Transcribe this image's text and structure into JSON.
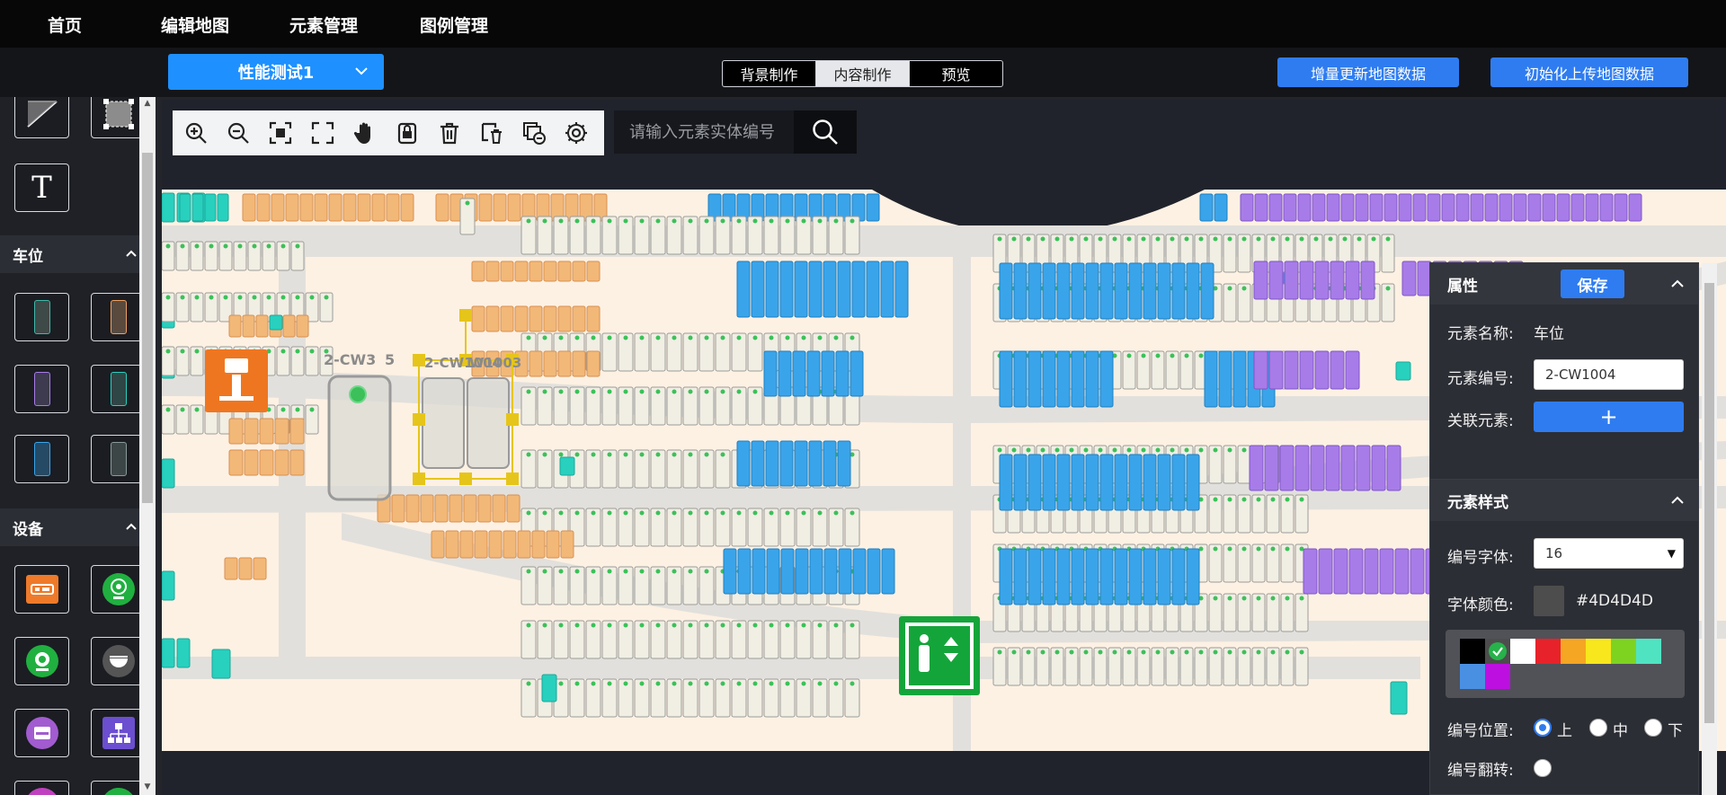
{
  "nav": {
    "items": [
      "首页",
      "编辑地图",
      "元素管理",
      "图例管理"
    ]
  },
  "subbar": {
    "project": "性能测试1",
    "tabs": [
      "背景制作",
      "内容制作",
      "预览"
    ],
    "active_tab": "内容制作",
    "incremental_update": "增量更新地图数据",
    "init_upload": "初始化上传地图数据"
  },
  "sidebar": {
    "sections": {
      "parking": "车位",
      "device": "设备"
    },
    "tools": [
      "polyline-tool",
      "rect-select-tool",
      "text-tool"
    ],
    "text_tool_glyph": "T"
  },
  "map": {
    "search_placeholder": "请输入元素实体编号",
    "labels": {
      "space_a": "2-CW3",
      "space_a_suffix": "5",
      "space_b": "2-CW1004",
      "space_c": "W1003"
    },
    "toolbar": [
      "zoom-in-icon",
      "zoom-out-icon",
      "fit-icon",
      "fullscreen-icon",
      "hand-icon",
      "lock-icon",
      "delete-icon",
      "delete-layer-icon",
      "remove-layer-icon",
      "settings-icon"
    ]
  },
  "props": {
    "title": "属性",
    "save": "保存",
    "name_label": "元素名称:",
    "name_value": "车位",
    "code_label": "元素编号:",
    "code_value": "2-CW1004",
    "link_label": "关联元素:",
    "link_btn": "+"
  },
  "style": {
    "title": "元素样式",
    "font_label": "编号字体:",
    "font_value": "16",
    "color_label": "字体颜色:",
    "color_value": "#4D4D4D",
    "palette": [
      "#000000",
      "#4D4D4D",
      "#FFFFFF",
      "#E8222A",
      "#F5A623",
      "#F8E71C",
      "#7ED321",
      "#50E3C2",
      "#4A90E2",
      "#BD10E0"
    ],
    "pos_label": "编号位置:",
    "pos_options": [
      "上",
      "中",
      "下"
    ],
    "pos_selected": "上",
    "flip_label": "编号翻转:"
  },
  "colors": {
    "accent": "#2F7CF0",
    "orange_space": "#F2B878",
    "blue_space": "#3AA4EA",
    "purple_space": "#A77CE8",
    "teal_space": "#28D0BE"
  }
}
